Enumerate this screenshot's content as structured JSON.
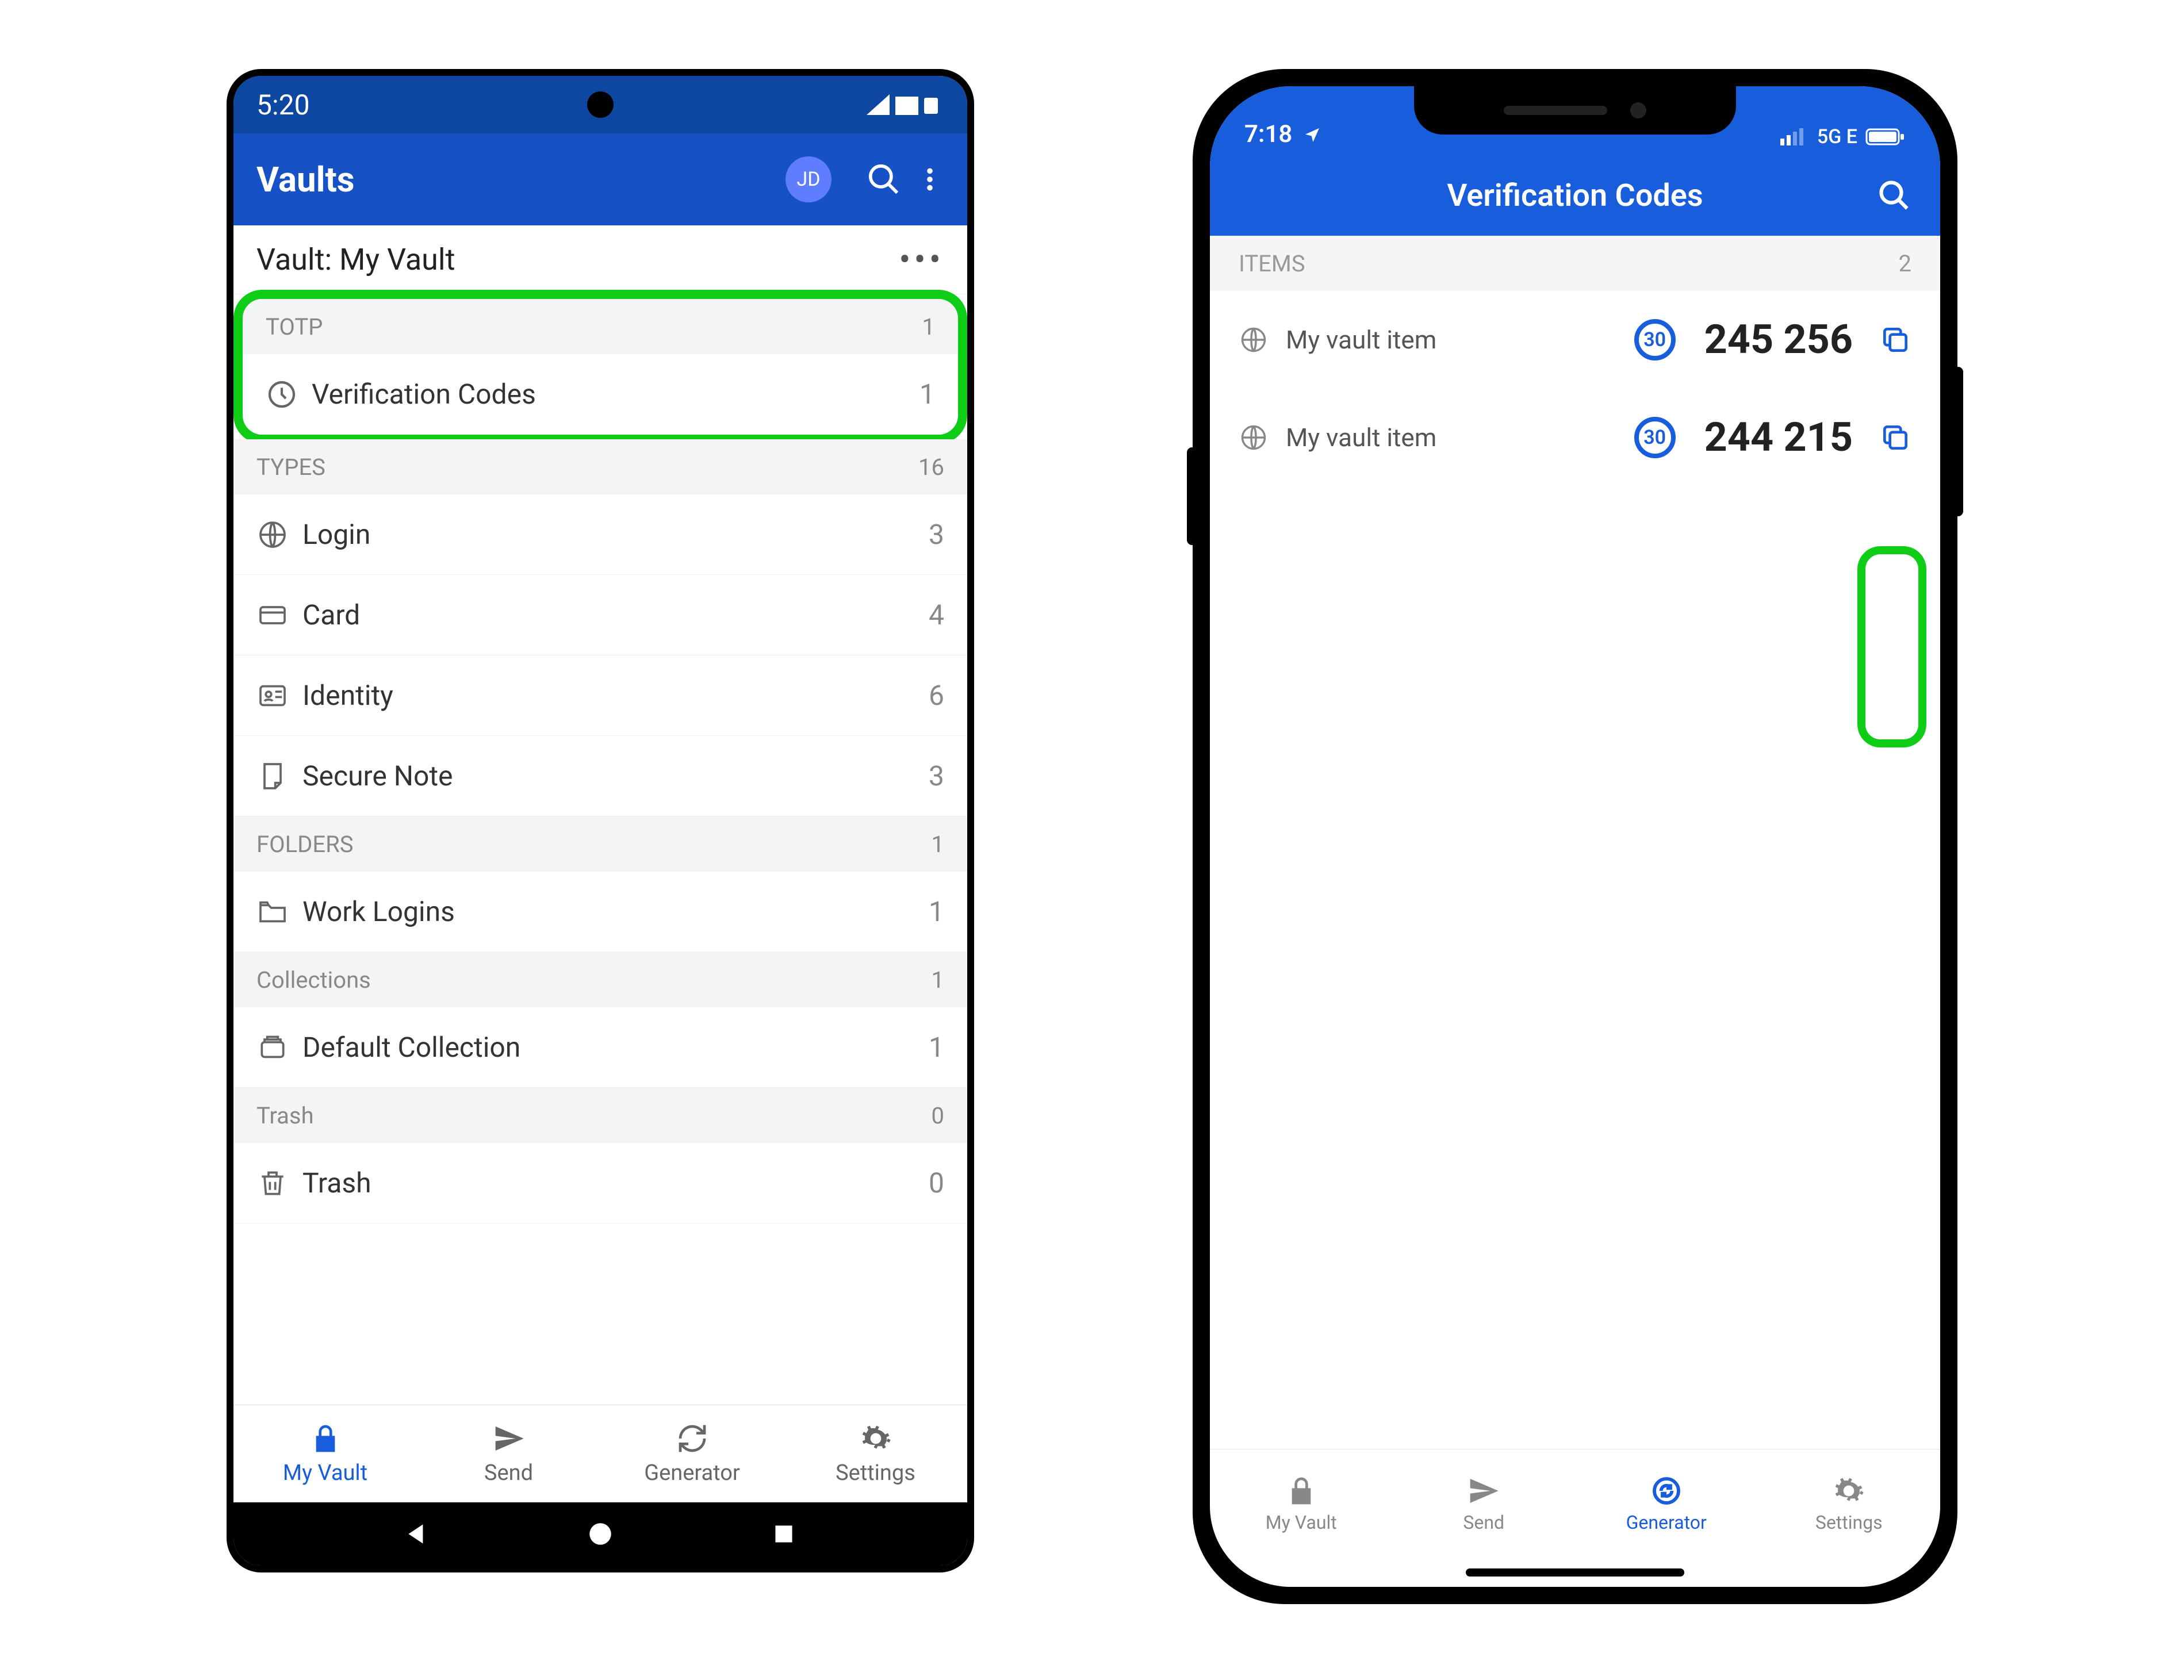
{
  "android": {
    "statusbar": {
      "time": "5:20"
    },
    "appbar": {
      "title": "Vaults",
      "avatar_initials": "JD"
    },
    "vault_header": "Vault: My Vault",
    "sections": {
      "totp": {
        "title": "TOTP",
        "count": "1",
        "items": [
          {
            "label": "Verification Codes",
            "count": "1"
          }
        ]
      },
      "types": {
        "title": "TYPES",
        "count": "16",
        "items": [
          {
            "label": "Login",
            "count": "3"
          },
          {
            "label": "Card",
            "count": "4"
          },
          {
            "label": "Identity",
            "count": "6"
          },
          {
            "label": "Secure Note",
            "count": "3"
          }
        ]
      },
      "folders": {
        "title": "FOLDERS",
        "count": "1",
        "items": [
          {
            "label": "Work Logins",
            "count": "1"
          }
        ]
      },
      "collections": {
        "title": "Collections",
        "count": "1",
        "items": [
          {
            "label": "Default Collection",
            "count": "1"
          }
        ]
      },
      "trash": {
        "title": "Trash",
        "count": "0",
        "items": [
          {
            "label": "Trash",
            "count": "0"
          }
        ]
      }
    },
    "bottomnav": {
      "vault": "My Vault",
      "send": "Send",
      "generator": "Generator",
      "settings": "Settings"
    }
  },
  "ios": {
    "statusbar": {
      "time": "7:18",
      "network": "5G E"
    },
    "appbar": {
      "title": "Verification Codes"
    },
    "section": {
      "title": "ITEMS",
      "count": "2"
    },
    "items": [
      {
        "name": "My vault item",
        "timer": "30",
        "code": "245 256"
      },
      {
        "name": "My vault item",
        "timer": "30",
        "code": "244 215"
      }
    ],
    "bottomnav": {
      "vault": "My Vault",
      "send": "Send",
      "generator": "Generator",
      "settings": "Settings"
    }
  }
}
